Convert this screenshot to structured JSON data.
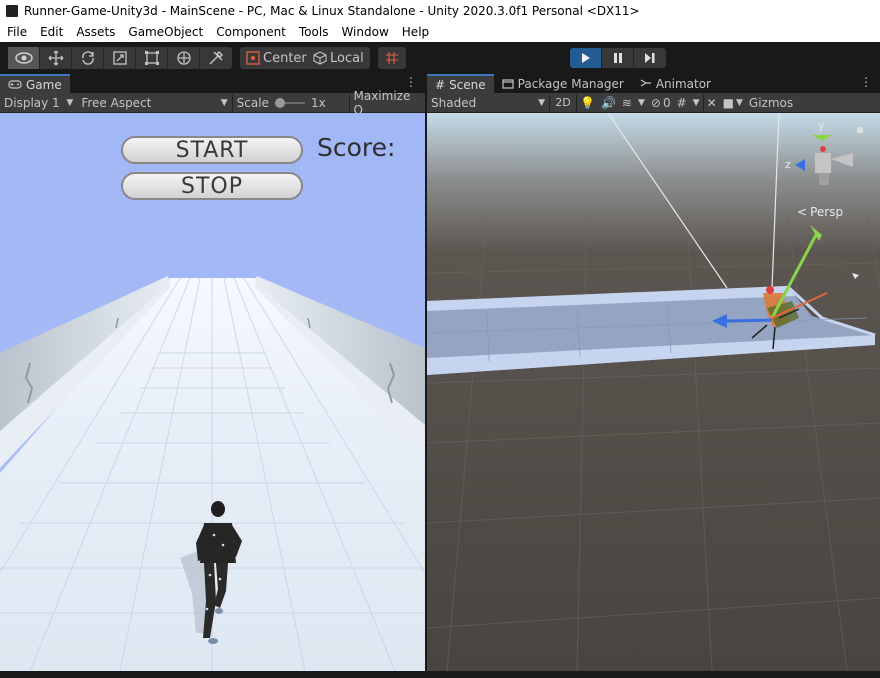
{
  "window": {
    "title": "Runner-Game-Unity3d - MainScene - PC, Mac & Linux Standalone - Unity 2020.3.0f1 Personal <DX11>"
  },
  "menu": [
    "File",
    "Edit",
    "Assets",
    "GameObject",
    "Component",
    "Tools",
    "Window",
    "Help"
  ],
  "toolbar": {
    "center_label": "Center",
    "local_label": "Local"
  },
  "game_panel": {
    "tab_label": "Game",
    "display_label": "Display 1",
    "aspect_label": "Free Aspect",
    "scale_label": "Scale",
    "scale_value": "1x",
    "maximize_label": "Maximize O",
    "start_label": "START",
    "stop_label": "STOP",
    "score_label": "Score:"
  },
  "scene_panel": {
    "tabs": [
      "Scene",
      "Package Manager",
      "Animator"
    ],
    "shading_label": "Shaded",
    "mode_2d_label": "2D",
    "hidden_count": "0",
    "gizmos_label": "Gizmos",
    "persp_label": "Persp",
    "axis_y": "y",
    "axis_z": "z"
  },
  "colors": {
    "accent": "#3a79bb",
    "play_active": "#235c93",
    "sky": "#a2b7f5"
  },
  "icons": [
    "eye-icon",
    "move-icon",
    "rotate-icon",
    "scale-icon",
    "rect-icon",
    "transform-icon",
    "custom-tool-icon",
    "center-icon",
    "local-icon",
    "snap-icon",
    "play-icon",
    "pause-icon",
    "step-icon",
    "gamepad-icon",
    "grid-icon",
    "package-icon",
    "animator-icon",
    "light-icon",
    "audio-icon",
    "effects-icon",
    "hidden-icon",
    "grid-snap-icon",
    "tools-icon",
    "camera-icon",
    "kebab-icon"
  ]
}
